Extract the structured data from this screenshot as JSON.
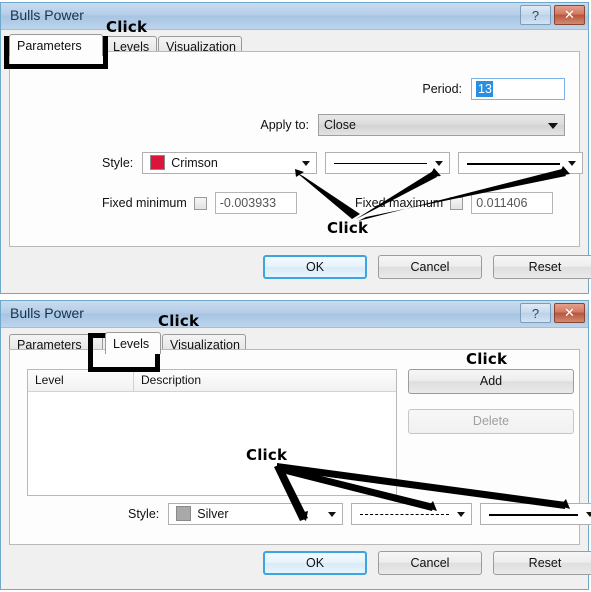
{
  "dialogs": [
    {
      "id": "parameters",
      "title": "Bulls Power",
      "titlebar": {
        "help_label": "?",
        "close_label": "✕"
      },
      "tabs": [
        {
          "label": "Parameters",
          "active": true
        },
        {
          "label": "Levels",
          "active": false
        },
        {
          "label": "Visualization",
          "active": false
        }
      ],
      "fields": {
        "period_label": "Period:",
        "period_value": "13",
        "apply_to_label": "Apply to:",
        "apply_to_value": "Close",
        "style_label": "Style:",
        "style_color_name": "Crimson",
        "style_color_hex": "#DC143C",
        "fixed_minimum_label": "Fixed minimum",
        "fixed_minimum_value": "-0.003933",
        "fixed_maximum_label": "Fixed maximum",
        "fixed_maximum_value": "0.011406"
      },
      "buttons": {
        "ok": "OK",
        "cancel": "Cancel",
        "reset": "Reset"
      },
      "annotations": [
        {
          "text": "Click",
          "target": "parameters-tab"
        },
        {
          "text": "Click",
          "target": "style-dropdowns"
        }
      ]
    },
    {
      "id": "levels",
      "title": "Bulls Power",
      "titlebar": {
        "help_label": "?",
        "close_label": "✕"
      },
      "tabs": [
        {
          "label": "Parameters",
          "active": false
        },
        {
          "label": "Levels",
          "active": true
        },
        {
          "label": "Visualization",
          "active": false
        }
      ],
      "grid": {
        "columns": [
          "Level",
          "Description"
        ],
        "rows": []
      },
      "side_buttons": [
        {
          "label": "Add",
          "disabled": false
        },
        {
          "label": "Delete",
          "disabled": true
        }
      ],
      "fields": {
        "style_label": "Style:",
        "style_color_name": "Silver",
        "style_color_hex": "#A9A9A9"
      },
      "buttons": {
        "ok": "OK",
        "cancel": "Cancel",
        "reset": "Reset"
      },
      "annotations": [
        {
          "text": "Click",
          "target": "levels-tab"
        },
        {
          "text": "Click",
          "target": "add-button"
        },
        {
          "text": "Click",
          "target": "style-dropdowns"
        }
      ]
    }
  ]
}
